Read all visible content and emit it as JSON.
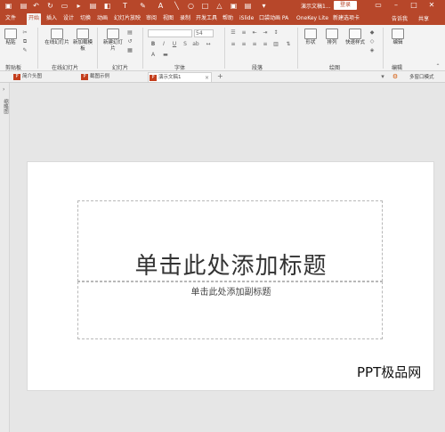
{
  "titlebar": {
    "doc_title": "演示文稿1...",
    "login_label": "登录",
    "icons": [
      "save-icon",
      "undo-icon",
      "redo-icon",
      "present-icon"
    ]
  },
  "tabs": [
    {
      "label": "文件"
    },
    {
      "label": "开始",
      "active": true
    },
    {
      "label": "插入"
    },
    {
      "label": "设计"
    },
    {
      "label": "切换"
    },
    {
      "label": "动画"
    },
    {
      "label": "幻灯片放映"
    },
    {
      "label": "审阅"
    },
    {
      "label": "视图"
    },
    {
      "label": "录制"
    },
    {
      "label": "开发工具"
    },
    {
      "label": "帮助"
    },
    {
      "label": "iSlide"
    },
    {
      "label": "口袋动画 PA"
    },
    {
      "label": "OneKey Lite"
    },
    {
      "label": "新建选项卡"
    }
  ],
  "tell_me": "告诉我",
  "share": "共享",
  "ribbon": {
    "groups": {
      "clipboard": "剪贴板",
      "online_slides": "在线幻灯片",
      "slides": "幻灯片",
      "font": "字体",
      "paragraph": "段落",
      "drawing": "绘图",
      "editing": "编辑"
    },
    "buttons": {
      "paste": "粘贴",
      "online_slides_btn": "在线幻灯片",
      "new_from_template": "新加载模板",
      "new_slide": "新建幻灯片",
      "shapes": "形状",
      "arrange": "排列",
      "quick_styles": "快速样式",
      "editing_btn": "编辑"
    },
    "font_size": "54"
  },
  "docstrip": {
    "tabs": [
      {
        "label": "简介头图"
      },
      {
        "label": "截图示例"
      },
      {
        "label": "演示文稿1",
        "active": true
      }
    ],
    "multi_window": "多窗口模式"
  },
  "thumbpane": {
    "label": "缩略图"
  },
  "slide": {
    "title_placeholder": "单击此处添加标题",
    "subtitle_placeholder": "单击此处添加副标题"
  },
  "watermark": "PPT极品网",
  "colors": {
    "accent": "#b7472a",
    "ribbon_bg": "#f3f3f3",
    "workspace_bg": "#e6e6e6"
  }
}
